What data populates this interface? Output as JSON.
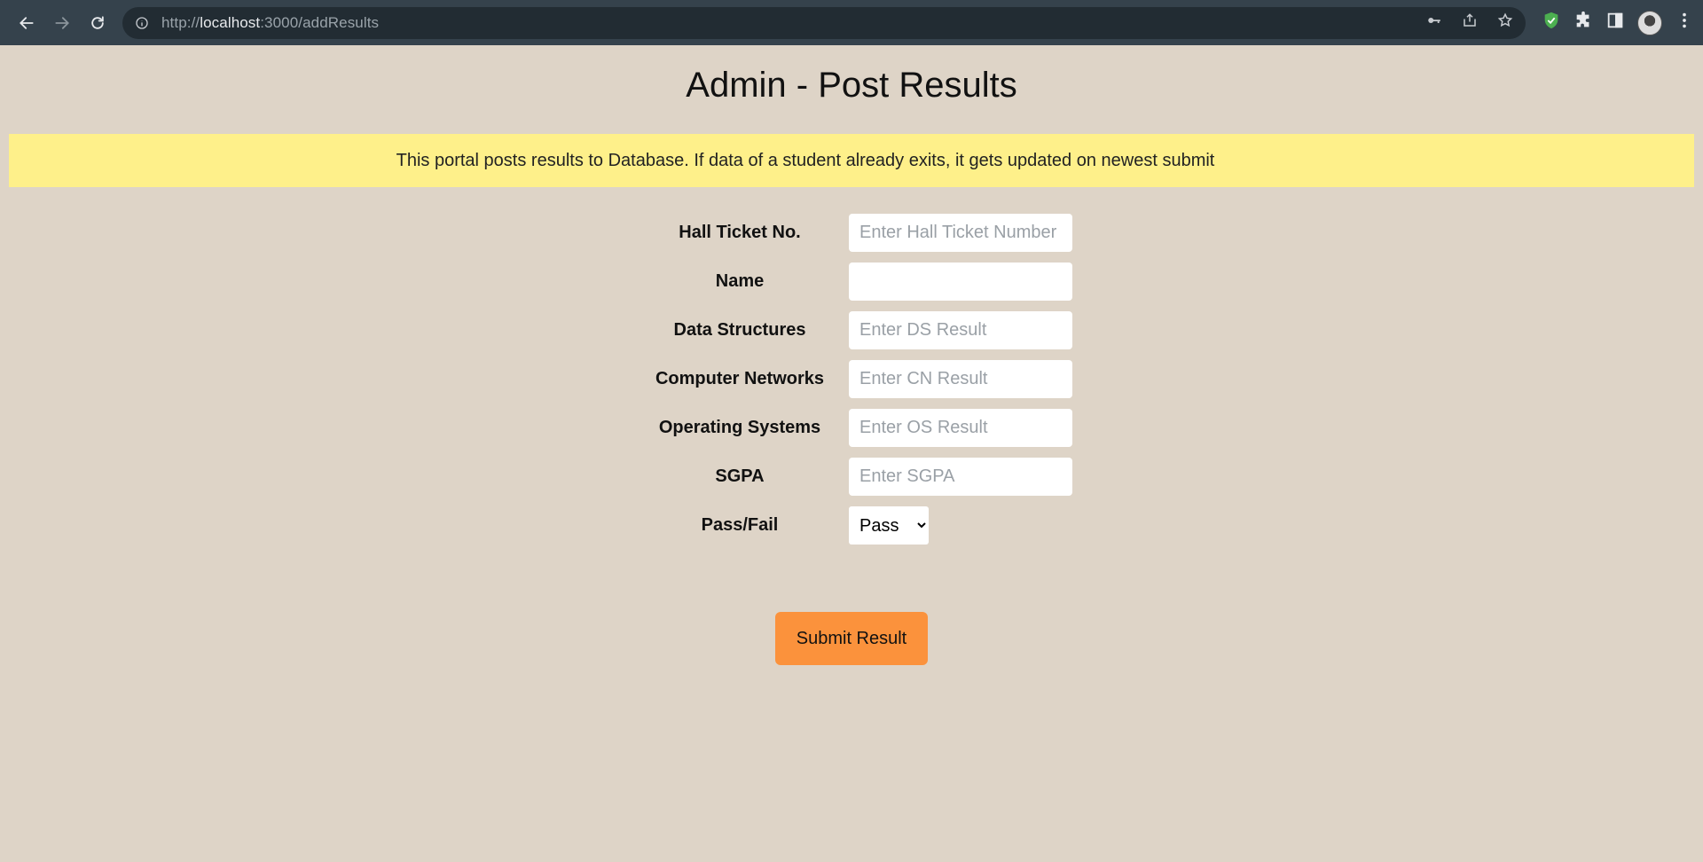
{
  "browser": {
    "url_scheme": "http://",
    "url_host": "localhost",
    "url_path": ":3000/addResults"
  },
  "page": {
    "title": "Admin - Post Results",
    "notice": "This portal posts results to Database. If data of a student already exits, it gets updated on newest submit"
  },
  "form": {
    "fields": [
      {
        "label": "Hall Ticket No.",
        "placeholder": "Enter Hall Ticket Number",
        "value": ""
      },
      {
        "label": "Name",
        "placeholder": "",
        "value": ""
      },
      {
        "label": "Data Structures",
        "placeholder": "Enter DS Result",
        "value": ""
      },
      {
        "label": "Computer Networks",
        "placeholder": "Enter CN Result",
        "value": ""
      },
      {
        "label": "Operating Systems",
        "placeholder": "Enter OS Result",
        "value": ""
      },
      {
        "label": "SGPA",
        "placeholder": "Enter SGPA",
        "value": ""
      }
    ],
    "pass_fail": {
      "label": "Pass/Fail",
      "selected": "Pass"
    },
    "submit_label": "Submit Result"
  },
  "colors": {
    "background": "#ded4c7",
    "notice": "#fef08a",
    "submit": "#fb923c"
  }
}
